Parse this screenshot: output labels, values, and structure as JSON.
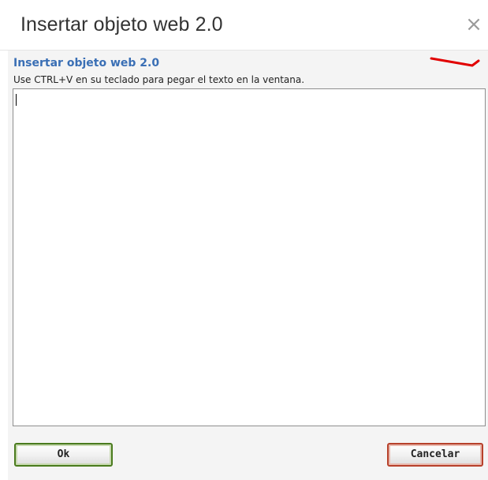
{
  "dialog": {
    "title": "Insertar objeto web 2.0",
    "close_glyph": "×",
    "section_title": "Insertar objeto web 2.0",
    "instructions": "Use CTRL+V en su teclado para pegar el texto en la ventana.",
    "paste_area": {
      "value": "",
      "placeholder": ""
    },
    "buttons": {
      "ok_label": "Ok",
      "cancel_label": "Cancelar"
    }
  },
  "colors": {
    "section_title": "#3a6fb5",
    "ok_border": "#4a7b1e",
    "cancel_border": "#b7412b",
    "annotation_arrow": "#e10000"
  },
  "icons": {
    "close": "close-icon",
    "annotation": "red-arrow-annotation"
  }
}
